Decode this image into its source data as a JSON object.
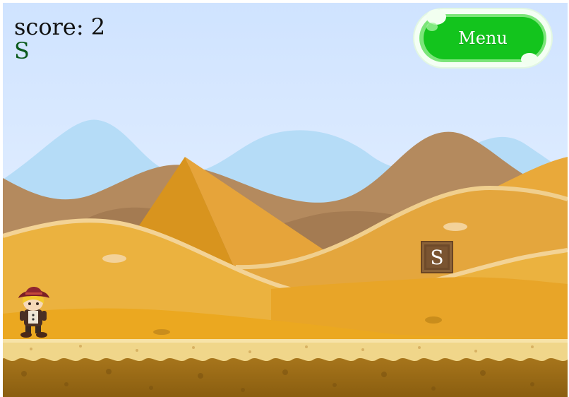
{
  "hud": {
    "score_text": "score: 2",
    "letter": "S"
  },
  "menu": {
    "label": "Menu",
    "icon": "pill-button"
  },
  "pickup": {
    "letter": "S",
    "icon": "wooden-crate"
  },
  "player": {
    "icon": "explorer-girl-hat"
  },
  "colors": {
    "sky_top": "#cfe3ff",
    "sky_bottom": "#e9f3ff",
    "far_mountains": "#b5dcf7",
    "brown_hills": "#b58a5c",
    "sand": "#e8ad3a",
    "sand_highlight": "#f3cd86",
    "ground_top": "#f0d68a",
    "ground_dirt": "#9a6a16",
    "menu_green": "#13c41d",
    "crate": "#7a5230"
  }
}
